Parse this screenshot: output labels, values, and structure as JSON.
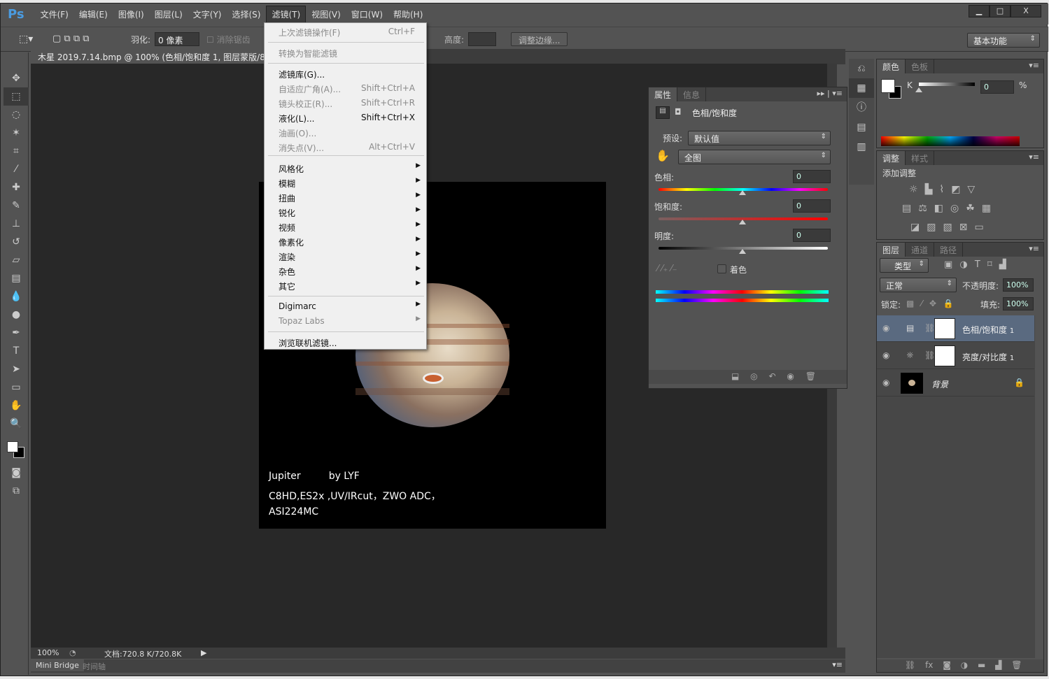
{
  "app": {
    "logo": "Ps",
    "menus": [
      "文件(F)",
      "编辑(E)",
      "图像(I)",
      "图层(L)",
      "文字(Y)",
      "选择(S)",
      "滤镜(T)",
      "视图(V)",
      "窗口(W)",
      "帮助(H)"
    ],
    "active_menu": "滤镜(T)",
    "window_buttons": [
      "▁",
      "□",
      "X"
    ]
  },
  "options": {
    "feather_label": "羽化:",
    "feather_value": "0 像素",
    "antialias_label": "消除锯齿",
    "height_label": "高度:",
    "refine_edge": "调整边缘...",
    "workspace": "基本功能"
  },
  "document": {
    "tab_title": "木星    2019.7.14.bmp @ 100% (色相/饱和度 1, 图层蒙版/8)",
    "caption": [
      "Jupiter         by LYF",
      "C8HD,ES2x ,UV/IRcut，ZWO ADC，",
      "ASI224MC"
    ]
  },
  "filter_menu": {
    "items": [
      {
        "label": "上次滤镜操作(F)",
        "shortcut": "Ctrl+F",
        "disabled": true
      },
      {
        "label": "转换为智能滤镜",
        "disabled": true
      },
      {
        "label": "滤镜库(G)...",
        "disabled": false
      },
      {
        "label": "自适应广角(A)...",
        "shortcut": "Shift+Ctrl+A",
        "disabled": true
      },
      {
        "label": "镜头校正(R)...",
        "shortcut": "Shift+Ctrl+R",
        "disabled": true
      },
      {
        "label": "液化(L)...",
        "shortcut": "Shift+Ctrl+X",
        "disabled": false
      },
      {
        "label": "油画(O)...",
        "disabled": true
      },
      {
        "label": "消失点(V)...",
        "shortcut": "Alt+Ctrl+V",
        "disabled": true
      },
      {
        "label": "风格化",
        "submenu": true
      },
      {
        "label": "模糊",
        "submenu": true
      },
      {
        "label": "扭曲",
        "submenu": true
      },
      {
        "label": "锐化",
        "submenu": true
      },
      {
        "label": "视频",
        "submenu": true
      },
      {
        "label": "像素化",
        "submenu": true
      },
      {
        "label": "渲染",
        "submenu": true
      },
      {
        "label": "杂色",
        "submenu": true
      },
      {
        "label": "其它",
        "submenu": true
      },
      {
        "label": "Digimarc",
        "submenu": true
      },
      {
        "label": "Topaz Labs",
        "submenu": true,
        "disabled": true
      },
      {
        "label": "浏览联机滤镜...",
        "disabled": false
      }
    ]
  },
  "properties": {
    "tabs": [
      "属性",
      "信息"
    ],
    "title": "色相/饱和度",
    "preset_label": "预设:",
    "preset_value": "默认值",
    "range_value": "全图",
    "hue_label": "色相:",
    "hue": "0",
    "saturation_label": "饱和度:",
    "saturation": "0",
    "lightness_label": "明度:",
    "lightness": "0",
    "colorize_label": "着色"
  },
  "color_panel": {
    "tabs": [
      "颜色",
      "色板"
    ],
    "channel": "K",
    "value": "0",
    "unit": "%"
  },
  "adjust_panel": {
    "tabs": [
      "调整",
      "样式"
    ],
    "title": "添加调整"
  },
  "layers_panel": {
    "tabs": [
      "图层",
      "通道",
      "路径"
    ],
    "filter": "类型",
    "blend_mode": "正常",
    "opacity_label": "不透明度:",
    "opacity": "100%",
    "lock_label": "锁定:",
    "fill_label": "填充:",
    "fill": "100%",
    "layers": [
      {
        "name": "色相/饱和度",
        "badge": "1",
        "selected": true
      },
      {
        "name": "亮度/对比度",
        "badge": "1"
      },
      {
        "name": "背景"
      }
    ]
  },
  "status": {
    "zoom": "100%",
    "doc_info": "文档:720.8 K/720.8K",
    "bottom_tabs": [
      "Mini Bridge",
      "时间轴"
    ]
  }
}
